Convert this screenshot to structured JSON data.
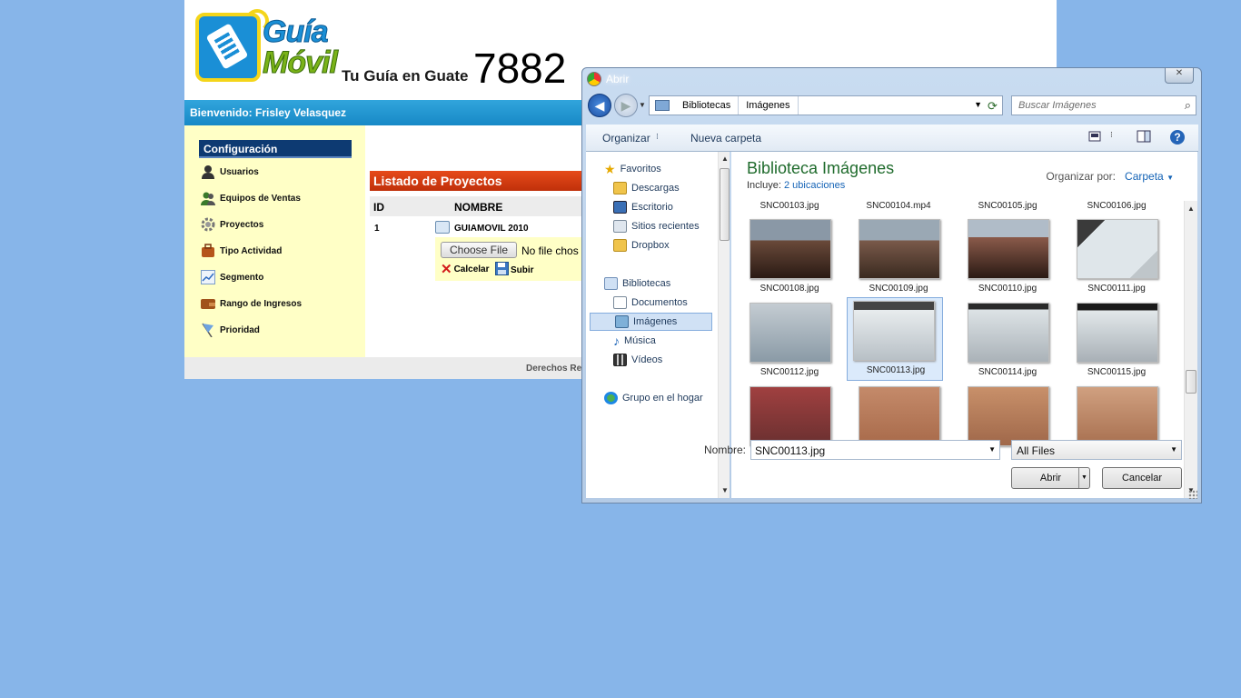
{
  "site": {
    "logo_line1": "Guía",
    "logo_line2": "Móvil",
    "tagline": "Tu Guía en Guate",
    "number": "7882",
    "welcome": "Bienvenido: Frisley Velasquez",
    "footer": "Derechos Re"
  },
  "sidebar": {
    "title": "Configuración",
    "items": [
      {
        "label": "Usuarios",
        "icon": "user-icon"
      },
      {
        "label": "Equipos de Ventas",
        "icon": "team-icon"
      },
      {
        "label": "Proyectos",
        "icon": "gear-icon"
      },
      {
        "label": "Tipo Actividad",
        "icon": "briefcase-icon"
      },
      {
        "label": "Segmento",
        "icon": "chart-icon"
      },
      {
        "label": "Rango de Ingresos",
        "icon": "wallet-icon"
      },
      {
        "label": "Prioridad",
        "icon": "flag-icon"
      }
    ]
  },
  "projects": {
    "header": "Listado de Proyectos",
    "col_id": "ID",
    "col_name": "NOMBRE",
    "rows": [
      {
        "id": "1",
        "name": "GUIAMOVIL 2010"
      }
    ],
    "choose_file": "Choose File",
    "no_file": "No file chos",
    "cancel": "Calcelar",
    "upload": "Subir"
  },
  "dialog": {
    "title": "Abrir",
    "breadcrumb": [
      "Bibliotecas",
      "Imágenes"
    ],
    "search_placeholder": "Buscar Imágenes",
    "toolbar": {
      "organize": "Organizar",
      "new_folder": "Nueva carpeta"
    },
    "nav": {
      "favorites": "Favoritos",
      "fav_items": [
        "Descargas",
        "Escritorio",
        "Sitios recientes",
        "Dropbox"
      ],
      "libraries": "Bibliotecas",
      "lib_items": [
        "Documentos",
        "Imágenes",
        "Música",
        "Vídeos"
      ],
      "homegroup": "Grupo en el hogar"
    },
    "library_title": "Biblioteca Imágenes",
    "includes_label": "Incluye:",
    "includes_value": "2 ubicaciones",
    "arrange_label": "Organizar por:",
    "arrange_value": "Carpeta",
    "files_row0": [
      "SNC00103.jpg",
      "SNC00104.mp4",
      "SNC00105.jpg",
      "SNC00106.jpg"
    ],
    "files_row1": [
      "SNC00108.jpg",
      "SNC00109.jpg",
      "SNC00110.jpg",
      "SNC00111.jpg"
    ],
    "files_row2": [
      "SNC00112.jpg",
      "SNC00113.jpg",
      "SNC00114.jpg",
      "SNC00115.jpg"
    ],
    "selected_file": "SNC00113.jpg",
    "filename_label": "Nombre:",
    "filename_value": "SNC00113.jpg",
    "filetype_value": "All Files",
    "open_button": "Abrir",
    "cancel_button": "Cancelar"
  }
}
